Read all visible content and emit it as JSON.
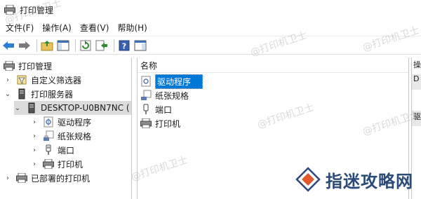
{
  "window": {
    "title": "打印管理"
  },
  "menu": [
    "文件(F)",
    "操作(A)",
    "查看(V)",
    "帮助(H)"
  ],
  "toolbar": {
    "buttons": [
      "back",
      "forward",
      "up-folder",
      "show-hide-tree",
      "refresh",
      "export-list",
      "help",
      "show-hide-action-pane"
    ]
  },
  "tree": {
    "root": "打印管理",
    "custom_filters": "自定义筛选器",
    "print_servers": "打印服务器",
    "server": "DESKTOP-U0BN7NC (",
    "drivers": "驱动程序",
    "forms": "纸张规格",
    "ports": "端口",
    "printers": "打印机",
    "deployed": "已部署的打印机"
  },
  "list": {
    "column_name": "名称",
    "items": [
      "驱动程序",
      "纸张规格",
      "端口",
      "打印机"
    ],
    "selected_index": 0
  },
  "actions_pane": {
    "header": "操",
    "btn1": "D",
    "btn2": "驱"
  },
  "watermarks": [
    "@打印机卫士",
    "@打印机卫士",
    "@打印机卫士",
    "@打印机卫士",
    "@打印机卫士",
    "@打印机卫士"
  ],
  "brand": {
    "text": "指迷攻略网"
  },
  "colors": {
    "selection": "#0078d7",
    "brand": "#2a4a78"
  }
}
